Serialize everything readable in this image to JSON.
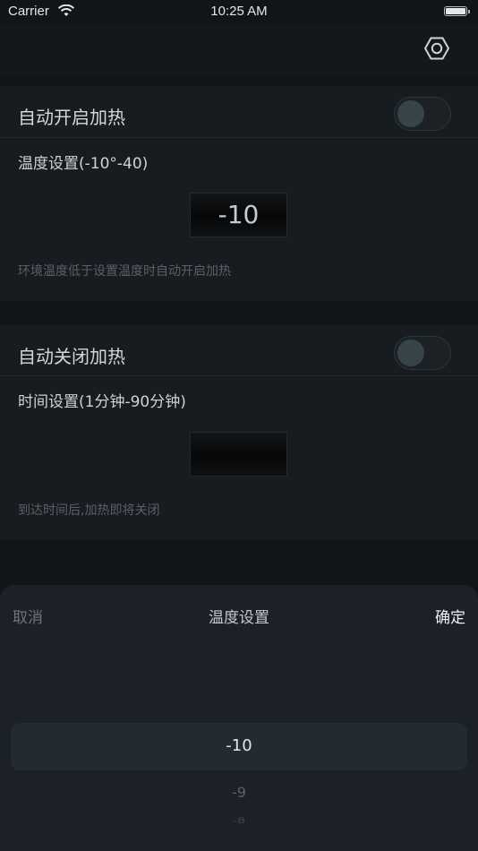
{
  "status_bar": {
    "carrier": "Carrier",
    "time": "10:25 AM"
  },
  "nav": {
    "settings_icon": "hexagon-settings-icon"
  },
  "auto_heat_on": {
    "label": "自动开启加热",
    "toggle_on": false,
    "setting_label": "温度设置(-10°-40)",
    "value": "-10",
    "hint": "环境温度低于设置温度时自动开启加热"
  },
  "auto_heat_off": {
    "label": "自动关闭加热",
    "toggle_on": false,
    "setting_label": "时间设置(1分钟-90分钟)",
    "value": "",
    "hint": "到达时间后,加热即将关闭"
  },
  "picker_sheet": {
    "cancel_label": "取消",
    "title": "温度设置",
    "confirm_label": "确定",
    "options": [
      "-10",
      "-9",
      "-8"
    ],
    "selected": "-10"
  }
}
